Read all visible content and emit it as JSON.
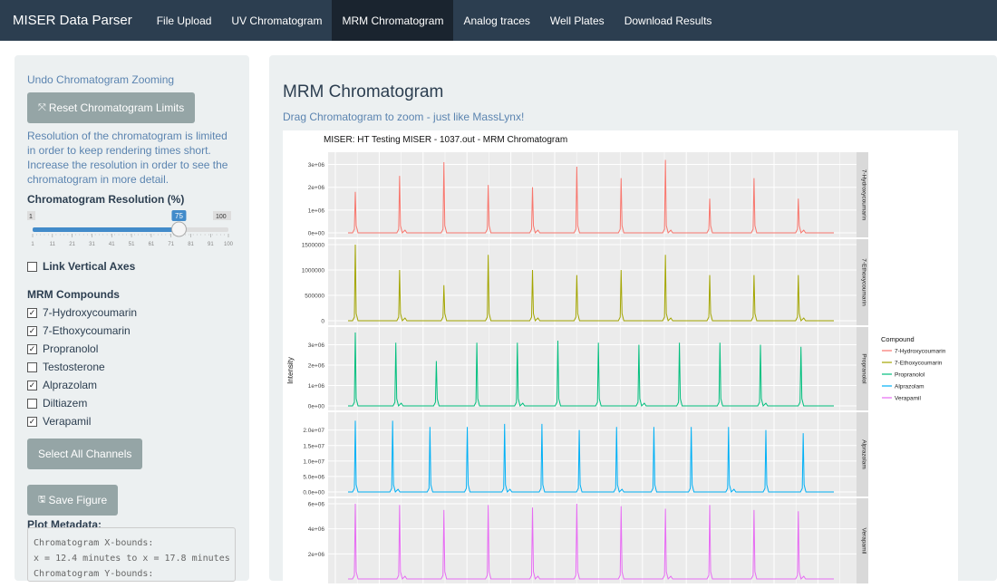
{
  "navbar": {
    "brand": "MISER Data Parser",
    "tabs": [
      "File Upload",
      "UV Chromatogram",
      "MRM Chromatogram",
      "Analog traces",
      "Well Plates",
      "Download Results"
    ],
    "active_index": 2
  },
  "sidebar": {
    "undo_link": "Undo Chromatogram Zooming",
    "reset_button": "Reset Chromatogram Limits",
    "help_text": "Resolution of the chromatogram is limited in order to keep rendering times short. Increase the resolution in order to see the chromatogram in more detail.",
    "resolution_label": "Chromatogram Resolution (%)",
    "slider": {
      "min": 1,
      "max": 100,
      "value": 75,
      "ticks": [
        1,
        11,
        21,
        31,
        41,
        51,
        61,
        71,
        81,
        91,
        100
      ]
    },
    "link_axes_label": "Link Vertical Axes",
    "link_axes_checked": false,
    "compounds_label": "MRM Compounds",
    "compounds": [
      {
        "label": "7-Hydroxycoumarin",
        "checked": true
      },
      {
        "label": "7-Ethoxycoumarin",
        "checked": true
      },
      {
        "label": "Propranolol",
        "checked": true
      },
      {
        "label": "Testosterone",
        "checked": false
      },
      {
        "label": "Alprazolam",
        "checked": true
      },
      {
        "label": "Diltiazem",
        "checked": false
      },
      {
        "label": "Verapamil",
        "checked": true
      }
    ],
    "select_all_button": "Select All Channels",
    "save_button": "Save Figure",
    "metadata_label": "Plot Metadata:",
    "metadata_lines": [
      "Chromatogram X-bounds:",
      "x = 12.4 minutes to x = 17.8 minutes",
      "Chromatogram Y-bounds:"
    ]
  },
  "main": {
    "title": "MRM Chromatogram",
    "subtitle": "Drag Chromatogram to zoom - just like MassLynx!"
  },
  "chart_data": {
    "type": "line",
    "title": "MISER: HT Testing MISER - 1037.out - MRM Chromatogram",
    "ylabel": "Intensity",
    "legend_title": "Compound",
    "legend_placement": "right",
    "grid": true,
    "series": [
      {
        "name": "7-Hydroxycoumarin",
        "color": "#f8766d",
        "yticks": [
          "0e+00",
          "1e+06",
          "2e+06",
          "3e+06"
        ],
        "ymax": 3300000.0,
        "peaks": [
          1800000.0,
          2500000.0,
          3100000.0,
          2100000.0,
          2000000.0,
          2900000.0,
          2400000.0,
          3200000.0,
          1500000.0,
          2400000.0,
          1500000.0
        ]
      },
      {
        "name": "7-Ethoxycoumarin",
        "color": "#a3a500",
        "yticks": [
          "0",
          "500000",
          "1000000",
          "1500000"
        ],
        "ymax": 1500000.0,
        "peaks": [
          1500000.0,
          1000000.0,
          700000.0,
          1300000.0,
          1000000.0,
          900000.0,
          1000000.0,
          1300000.0,
          900000.0,
          900000.0,
          900000.0
        ]
      },
      {
        "name": "Propranolol",
        "color": "#00bf7d",
        "yticks": [
          "0e+00",
          "1e+06",
          "2e+06",
          "3e+06"
        ],
        "ymax": 3600000.0,
        "peaks": [
          3600000.0,
          3100000.0,
          2200000.0,
          3100000.0,
          3100000.0,
          3200000.0,
          3100000.0,
          3000000.0,
          3100000.0,
          3100000.0,
          3000000.0,
          2900000.0
        ]
      },
      {
        "name": "Alprazolam",
        "color": "#00b0f6",
        "yticks": [
          "0.0e+00",
          "5.0e+06",
          "1.0e+07",
          "1.5e+07",
          "2.0e+07"
        ],
        "ymax": 24000000.0,
        "peaks": [
          23000000.0,
          23000000.0,
          21000000.0,
          21000000.0,
          22000000.0,
          22000000.0,
          20000000.0,
          21000000.0,
          21000000.0,
          21000000.0,
          21000000.0,
          20000000.0,
          19000000.0
        ]
      },
      {
        "name": "Verapamil",
        "color": "#e76bf3",
        "yticks": [
          "2e+06",
          "4e+06",
          "6e+06"
        ],
        "ymax": 6000000.0,
        "peaks": [
          6000000.0,
          5900000.0,
          5500000.0,
          5900000.0,
          5700000.0,
          6000000.0,
          5800000.0,
          5600000.0,
          5900000.0,
          5500000.0,
          5400000.0
        ]
      }
    ]
  }
}
